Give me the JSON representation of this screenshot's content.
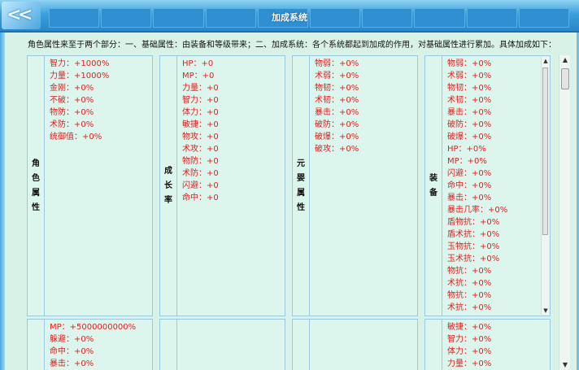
{
  "title": "加成系统",
  "description": "角色属性来至于两个部分：一、基础属性：由装备和等级带来；二、加成系统：各个系统都起到加成的作用，对基础属性进行累加。具体加成如下：",
  "panels": [
    {
      "label": [
        "角",
        "色",
        "属",
        "性"
      ],
      "stats": [
        "智力：+1000%",
        "力量：+1000%",
        "金刚：+0%",
        "不破：+0%",
        "物防：+0%",
        "术防：+0%",
        "统御值：+0%"
      ]
    },
    {
      "label": [
        "成",
        "长",
        "率"
      ],
      "stats": [
        "HP：+0",
        "MP：+0",
        "力量：+0",
        "智力：+0",
        "体力：+0",
        "敏捷：+0",
        "物攻：+0",
        "术攻：+0",
        "物防：+0",
        "术防：+0",
        "闪避：+0",
        "命中：+0"
      ]
    },
    {
      "label": [
        "元",
        "婴",
        "属",
        "性"
      ],
      "stats": [
        "物弱：+0%",
        "术弱：+0%",
        "物韧：+0%",
        "术韧：+0%",
        "暴击：+0%",
        "破防：+0%",
        "破爆：+0%",
        "破攻：+0%"
      ]
    },
    {
      "label": [
        "装",
        "备"
      ],
      "stats": [
        "物弱：+0%",
        "术弱：+0%",
        "物韧：+0%",
        "术韧：+0%",
        "暴击：+0%",
        "破防：+0%",
        "破爆：+0%",
        "HP：+0%",
        "MP：+0%",
        "闪避：+0%",
        "命中：+0%",
        "暴击：+0%",
        "暴击几率：+0%",
        "盾物抗：+0%",
        "盾术抗：+0%",
        "玉物抗：+0%",
        "玉术抗：+0%",
        "物抗：+0%",
        "术抗：+0%",
        "物抗：+0%",
        "术抗：+0%"
      ]
    }
  ],
  "lower_panels": [
    {
      "stats": [
        "MP：+5000000000%",
        "躲避：+0%",
        "命中：+0%",
        "暴击：+0%"
      ]
    },
    {
      "stats": []
    },
    {
      "stats": []
    },
    {
      "stats": [
        "敏捷：+0%",
        "智力：+0%",
        "体力：+0%",
        "力量：+0%"
      ]
    }
  ],
  "scroll_up_glyph": "▲",
  "scroll_down_glyph": "▼"
}
